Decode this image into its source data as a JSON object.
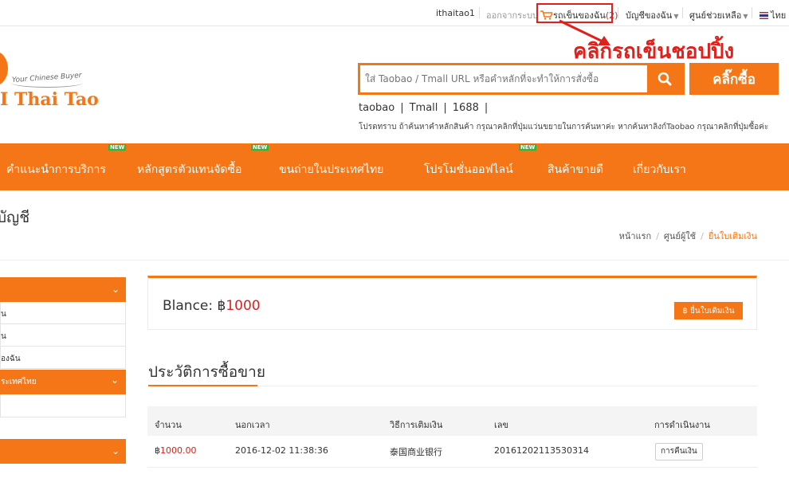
{
  "topbar": {
    "username": "ithaitao1",
    "logout": "ออกจากระบบ",
    "cart_label": "รถเข็นของฉัน",
    "cart_count": "(2)",
    "account": "บัญชีของฉัน",
    "help": "ศูนย์ช่วยเหลือ",
    "language": "ไทย"
  },
  "annotation": "คลิกรถเข็นชอปปิ้ง",
  "logo": {
    "tagline": "Your Chinese Buyer",
    "name": "Thai Tao"
  },
  "search": {
    "placeholder": "ใส่ Taobao / Tmall URL หรือคำหลักที่จะทำให้การสั่งซื้อ",
    "buy_button": "คลิ๊กซื้อ",
    "quick_links": [
      "taobao",
      "Tmall",
      "1688"
    ],
    "notice": "โปรดทราบ ถ้าค้นหาคำหลักสินค้า กรุณาคลิกที่ปุ่มแว่นขยายในการค้นหาค่ะ หากค้นหาลิงก์Taobao กรุณาคลิกที่ปุ่มซื้อค่ะ"
  },
  "nav": {
    "new_badge": "NEW",
    "items": [
      {
        "label": "คำแนะนำการบริการ"
      },
      {
        "label": "หลักสูตรตัวแทนจัดซื้อ"
      },
      {
        "label": "ขนถ่ายในประเทศไทย"
      },
      {
        "label": "โปรโมชั่นออฟไลน์"
      },
      {
        "label": "สินค้าขายดี"
      },
      {
        "label": "เกี่ยวกับเรา"
      }
    ]
  },
  "page": {
    "title": "บัญชี",
    "breadcrumb": [
      "หน้าแรก",
      "ศูนย์ผู้ใช้",
      "ยื่นใบเติมเงิน"
    ]
  },
  "sidebar": {
    "rows": [
      "น",
      "น",
      "องฉัน",
      "ระเทศไทย",
      ""
    ]
  },
  "balance": {
    "label": "Blance: ฿",
    "amount": "1000",
    "withdraw_button": "฿ ยื่นใบเติมเงิน"
  },
  "history": {
    "title": "ประวัติการซื้อขาย",
    "columns": [
      "จำนวน",
      "นอกเวลา",
      "วิธีการเติมเงิน",
      "เลข",
      "การดำเนินงาน"
    ],
    "rows": [
      {
        "currency": "฿",
        "amount": "1000.00",
        "time": "2016-12-02 11:38:36",
        "method": "泰国商业银行",
        "number": "20161202113530314",
        "action": "การคืนเงิน"
      }
    ]
  },
  "colors": {
    "brand_orange": "#f57617",
    "highlight_red": "#e0201c"
  }
}
